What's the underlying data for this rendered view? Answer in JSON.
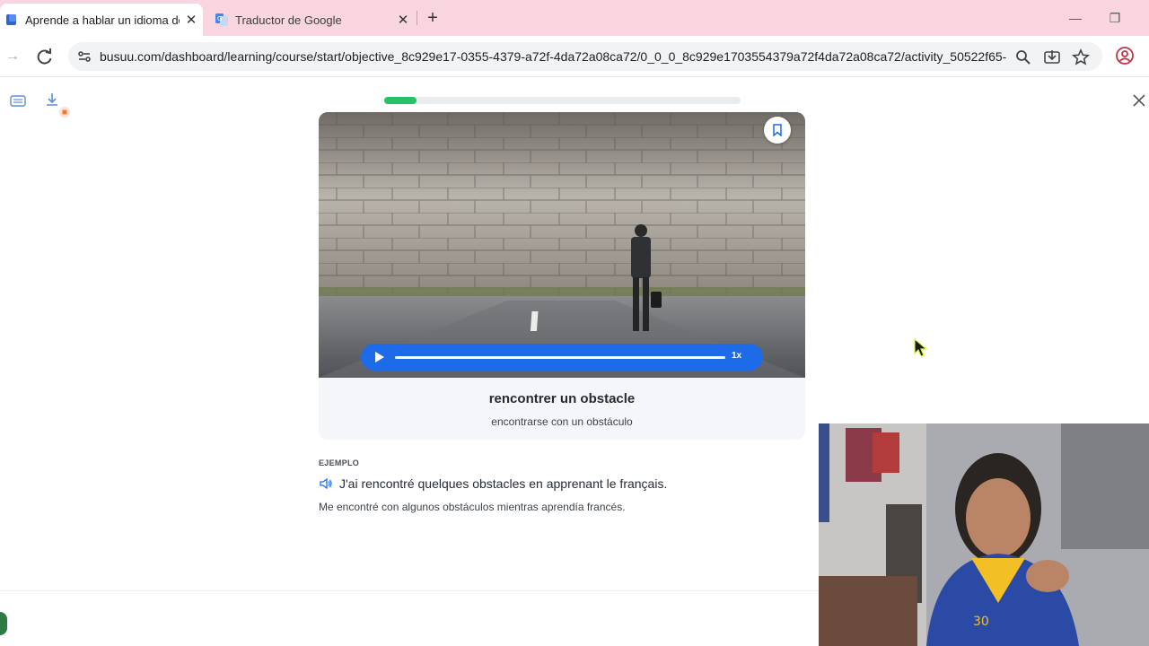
{
  "browser": {
    "tabs": [
      {
        "title": "Aprende a hablar un idioma de",
        "close": "✕"
      },
      {
        "title": "Traductor de Google",
        "close": "✕"
      }
    ],
    "new_tab": "+",
    "url": "busuu.com/dashboard/learning/course/start/objective_8c929e17-0355-4379-a72f-4da72a08ca72/0_0_0_8c929e1703554379a72f4da72a08ca72/activity_50522f65-f..."
  },
  "lesson": {
    "progress_fraction": 0.09,
    "word": "rencontrer un obstacle",
    "word_translation": "encontrarse con un obstáculo",
    "audio_speed": "1x",
    "example_label": "EJEMPLO",
    "example_sentence": "J'ai rencontré quelques obstacles en apprenant le français.",
    "example_translation": "Me encontré con algunos obstáculos mientras aprendía francés."
  },
  "colors": {
    "tab_strip": "#f9d5df",
    "progress": "#27c267",
    "player": "#1e6bea"
  },
  "icons": [
    "reload-icon",
    "forward-icon",
    "site-info-icon",
    "zoom-icon",
    "install-icon",
    "star-icon",
    "profile-icon",
    "bookmark-icon",
    "play-icon",
    "speaker-icon",
    "close-icon"
  ]
}
